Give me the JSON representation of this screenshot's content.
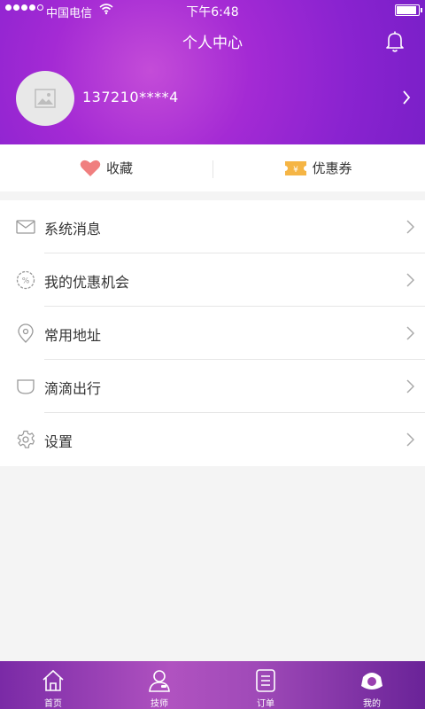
{
  "status_bar": {
    "carrier": "中国电信",
    "time": "下午6:48"
  },
  "header": {
    "title": "个人中心",
    "phone": "137210****4"
  },
  "quick_actions": [
    {
      "label": "收藏",
      "icon": "heart-icon",
      "color": "#f07f7f"
    },
    {
      "label": "优惠券",
      "icon": "coupon-icon",
      "color": "#f5b545"
    }
  ],
  "menu": [
    {
      "label": "系统消息",
      "icon": "mail-icon"
    },
    {
      "label": "我的优惠机会",
      "icon": "discount-icon"
    },
    {
      "label": "常用地址",
      "icon": "location-icon"
    },
    {
      "label": "滴滴出行",
      "icon": "cup-icon"
    },
    {
      "label": "设置",
      "icon": "gear-icon"
    }
  ],
  "tabbar": [
    {
      "label": "首页",
      "icon": "home-icon"
    },
    {
      "label": "技师",
      "icon": "technician-icon"
    },
    {
      "label": "订单",
      "icon": "order-icon"
    },
    {
      "label": "我的",
      "icon": "profile-icon",
      "active": true
    }
  ],
  "colors": {
    "header_primary": "#9a27d2",
    "tabbar_primary": "#a04ab8"
  }
}
